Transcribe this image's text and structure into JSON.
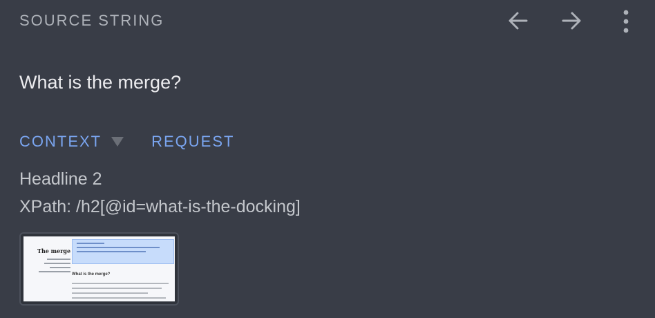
{
  "header": {
    "title": "SOURCE STRING",
    "back_icon": "arrow-left-icon",
    "forward_icon": "arrow-right-icon",
    "more_icon": "more-vertical-icon"
  },
  "source": {
    "text": "What is the merge?"
  },
  "tabs": {
    "context_label": "CONTEXT",
    "request_label": "REQUEST"
  },
  "context": {
    "element_type": "Headline 2",
    "xpath": "XPath: /h2[@id=what-is-the-docking]"
  },
  "thumbnail": {
    "heading": "The merge",
    "subheading": "What is the merge?"
  },
  "colors": {
    "background": "#393d47",
    "accent": "#7aa5f0",
    "muted_text": "#aeb2b9"
  }
}
